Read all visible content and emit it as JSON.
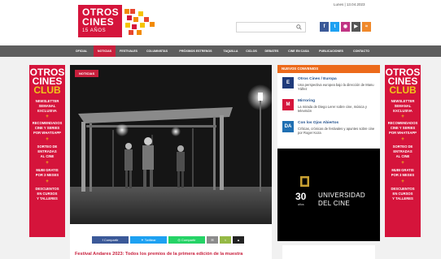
{
  "header": {
    "logo": {
      "line1": "OTROS",
      "line2": "CINES",
      "line3": "15 AÑOS"
    },
    "date": "Lunes | 13.04.2023",
    "search": {
      "placeholder": ""
    },
    "social_icons": [
      "facebook-icon",
      "twitter-icon",
      "instagram-icon",
      "youtube-icon",
      "rss-icon"
    ]
  },
  "nav": {
    "items": [
      "OFICIAL",
      "NOTICIAS",
      "FESTIVALES",
      "COLUMNISTAS",
      "PRÓXIMOS ESTRENOS",
      "TAQUILLA",
      "CICLOS",
      "DEBATES",
      "CINE EN CASA",
      "PUBLICACIONES",
      "CONTACTO"
    ],
    "active": "NOTICIAS"
  },
  "side_banner": {
    "title1": "OTROS",
    "title2": "CINES",
    "club": "CLUB",
    "lines": [
      "NEWSLETTER",
      "SEMANAL",
      "EXCLUSIVA",
      "+",
      "RECOMENDADOS",
      "CINE Y SERIES",
      "POR WHATSAPP",
      "+",
      "SORTEO DE",
      "ENTRADAS",
      "AL CINE",
      "+",
      "MUBI GRATIS",
      "POR 3 MESES",
      "+",
      "DESCUENTOS",
      "EN CURSOS",
      "Y TALLERES"
    ]
  },
  "article": {
    "tag": "NOTICIAS",
    "share": [
      "Compartir",
      "Twittear",
      "Compartir",
      "✉",
      "<",
      "▲"
    ],
    "headline": "Festival Andares 2023: Todos los premios de la primera edición de la muestra"
  },
  "new_sections": {
    "header": "NUEVOS CONVENIOS",
    "items": [
      {
        "icon": "E",
        "title": "Otros Cines / Europa",
        "desc": "Una perspectiva europea bajo la dirección de Manu Yáñez"
      },
      {
        "icon": "M",
        "title": "Mirroring",
        "desc": "La mirada de Diego Lerer sobre cine, música y televisión"
      },
      {
        "icon": "DA",
        "title": "Con los Ojos Abiertos",
        "desc": "Críticas, crónicas de festivales y apuntes sobre cine por Roger Koza"
      }
    ]
  },
  "ad": {
    "number": "30",
    "years": "años",
    "line1": "UNIVERSIDAD",
    "line2": "DEL CINE"
  },
  "colors": {
    "brand_red": "#d5143b",
    "nav_gray": "#5e5e5e",
    "accent_orange": "#ec6a1b",
    "link_blue": "#1f4f8c",
    "facebook": "#3b5998",
    "twitter": "#1da1f2",
    "whatsapp": "#25d366"
  }
}
